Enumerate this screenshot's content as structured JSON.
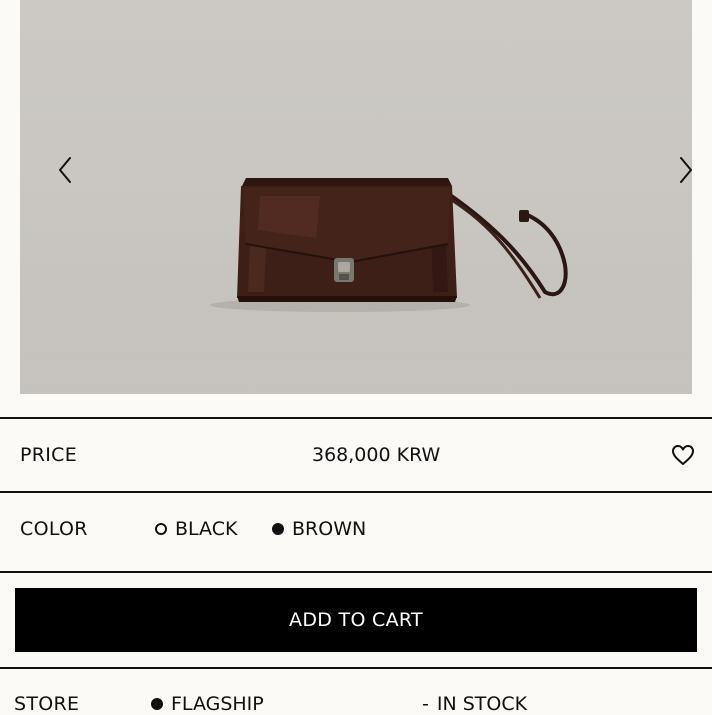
{
  "product": {
    "image_alt": "brown leather shoulder bag with push lock"
  },
  "gallery": {
    "prev_icon": "chevron-left-icon",
    "next_icon": "chevron-right-icon"
  },
  "price": {
    "label": "PRICE",
    "value": "368,000 KRW",
    "wishlist_icon": "heart-icon"
  },
  "color": {
    "label": "COLOR",
    "options": [
      {
        "label": "BLACK",
        "selected": false
      },
      {
        "label": "BROWN",
        "selected": true
      }
    ]
  },
  "cart": {
    "button_label": "ADD TO CART"
  },
  "store": {
    "label": "STORE",
    "name": "FLAGSHIP",
    "status_prefix": "-",
    "status": "IN STOCK"
  },
  "colors": {
    "background": "#fbfaf7",
    "button": "#000000",
    "bag_leather": "#3d1f18"
  }
}
